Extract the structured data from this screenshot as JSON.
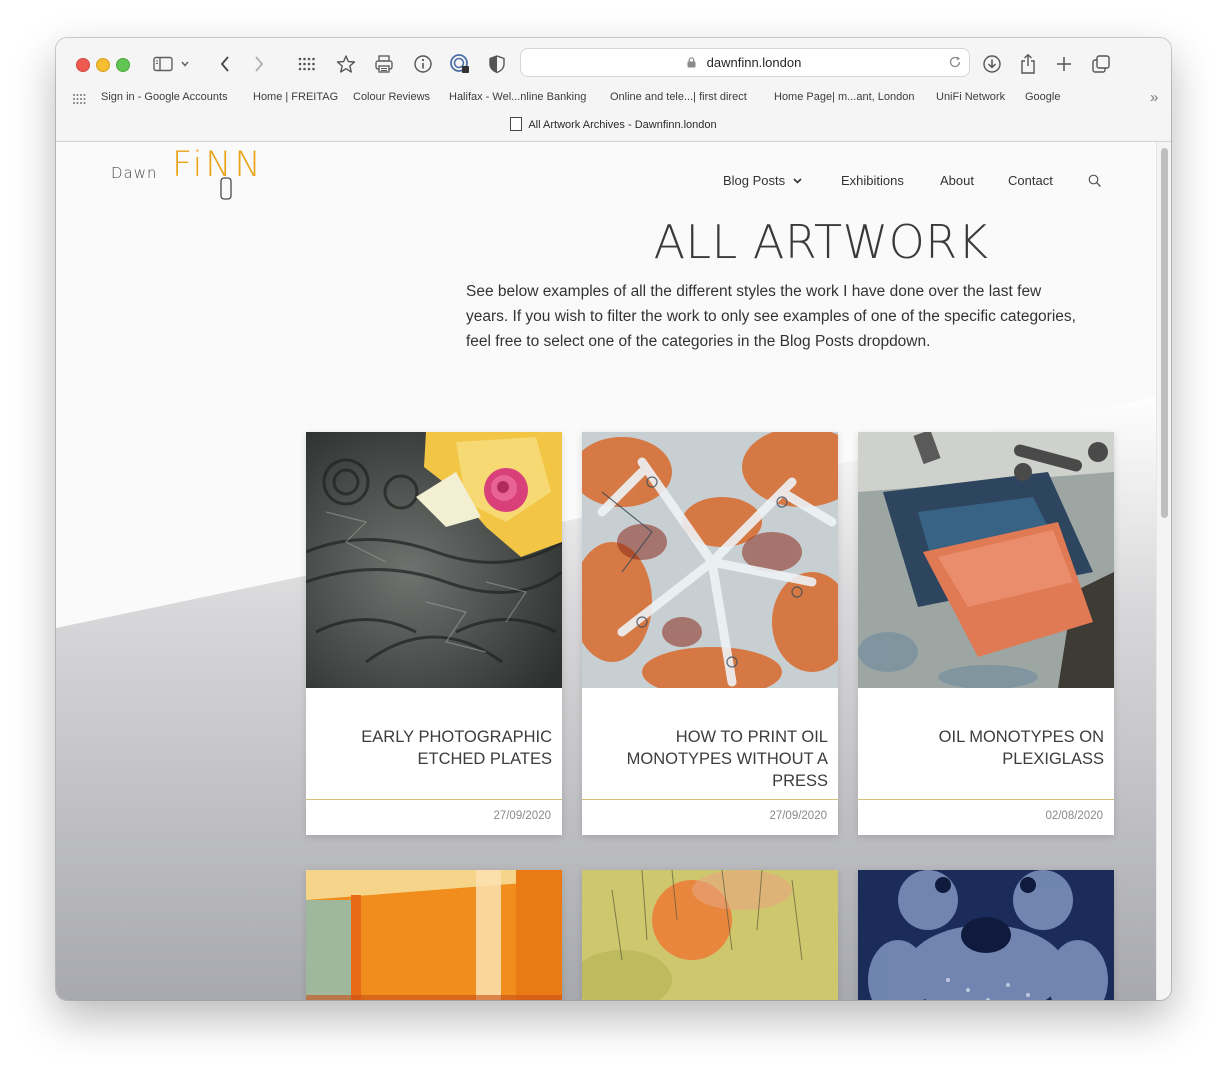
{
  "browser": {
    "url": "dawnfinn.london",
    "tab_title": "All Artwork Archives - Dawnfinn.london",
    "bookmarks": [
      "Sign in - Google Accounts",
      "Home | FREITAG",
      "Colour Reviews",
      "Halifax - Wel...nline Banking",
      "Online and tele...| first direct",
      "Home Page| m...ant, London",
      "UniFi Network",
      "Google"
    ],
    "overflow_label": "»"
  },
  "site": {
    "logo_dawn": "Dawn",
    "logo_finn": "FiNN",
    "nav": {
      "blog_posts": "Blog Posts",
      "exhibitions": "Exhibitions",
      "about": "About",
      "contact": "Contact"
    }
  },
  "page": {
    "title": "ALL ARTWORK",
    "intro": "See below examples of all the different styles the work I have done over the last few years. If you wish to filter the work to only see examples of one of the specific categories, feel free to select one of the categories in the Blog Posts dropdown."
  },
  "cards": [
    {
      "title": "EARLY PHOTOGRAPHIC ETCHED PLATES",
      "date": "27/09/2020"
    },
    {
      "title": "HOW TO PRINT OIL MONOTYPES WITHOUT A PRESS",
      "date": "27/09/2020"
    },
    {
      "title": "OIL MONOTYPES ON PLEXIGLASS",
      "date": "02/08/2020"
    }
  ],
  "colors": {
    "accent": "#e8a317",
    "card_rule": "#d9c07a",
    "text": "#333333"
  }
}
